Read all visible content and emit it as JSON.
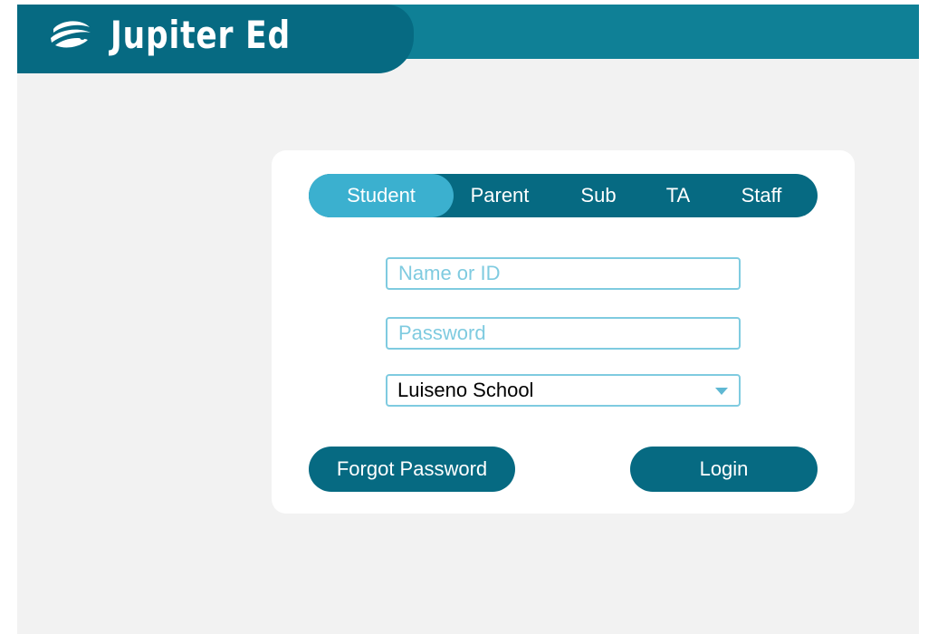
{
  "brand": {
    "name": "Jupiter Ed",
    "icon": "jupiter-logo-icon"
  },
  "colors": {
    "header": "#0f8096",
    "logo_tab": "#066a82",
    "active_tab": "#3bb0cf",
    "field_border": "#7fcbe0",
    "background": "#f2f2f2"
  },
  "login": {
    "tabs": [
      {
        "label": "Student",
        "active": true
      },
      {
        "label": "Parent",
        "active": false
      },
      {
        "label": "Sub",
        "active": false
      },
      {
        "label": "TA",
        "active": false
      },
      {
        "label": "Staff",
        "active": false
      }
    ],
    "name_field": {
      "placeholder": "Name or ID",
      "value": ""
    },
    "password_field": {
      "placeholder": "Password",
      "value": ""
    },
    "school_select": {
      "value": "Luiseno School"
    },
    "forgot_label": "Forgot Password",
    "login_label": "Login"
  }
}
